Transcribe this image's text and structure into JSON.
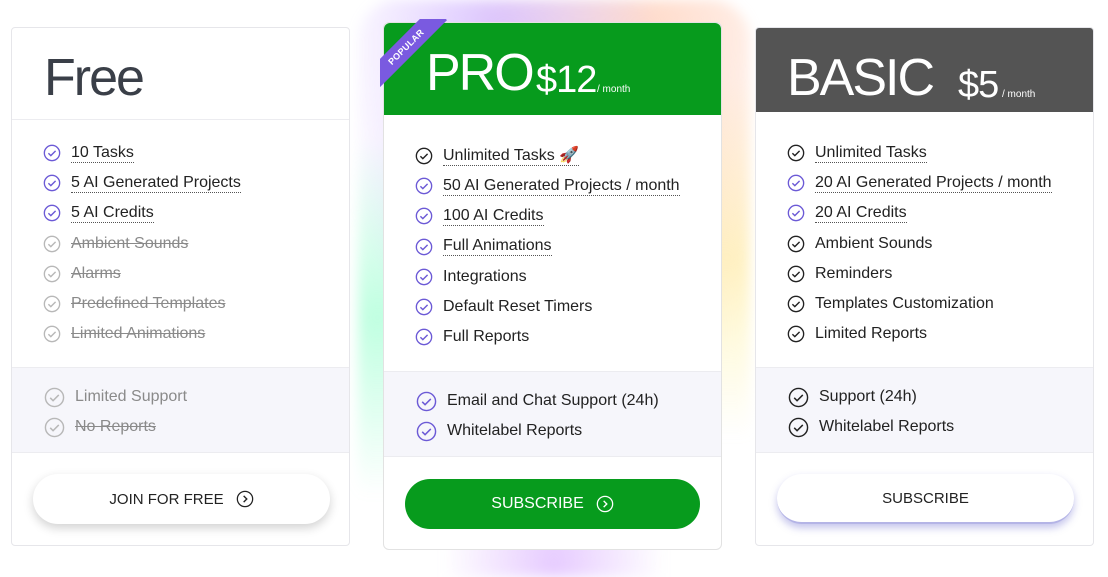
{
  "plans": {
    "free": {
      "name": "Free",
      "features": [
        {
          "text": "10 Tasks",
          "state": "included"
        },
        {
          "text": "5 AI Generated Projects",
          "state": "included"
        },
        {
          "text": "5 AI Credits",
          "state": "included"
        },
        {
          "text": "Ambient Sounds",
          "state": "excluded"
        },
        {
          "text": "Alarms",
          "state": "excluded"
        },
        {
          "text": "Predefined Templates",
          "state": "excluded"
        },
        {
          "text": "Limited Animations",
          "state": "excluded"
        }
      ],
      "support": [
        "Limited Support",
        "No Reports"
      ],
      "button": "JOIN FOR FREE"
    },
    "pro": {
      "badge": "POPULAR",
      "name": "PRO",
      "price": "$12",
      "period": "/ month",
      "features": [
        "Unlimited Tasks 🚀",
        "50 AI Generated Projects / month",
        "100 AI Credits",
        "Full Animations",
        "Integrations",
        "Default Reset Timers",
        "Full Reports"
      ],
      "support": [
        "Email and Chat Support (24h)",
        "Whitelabel Reports"
      ],
      "button": "SUBSCRIBE"
    },
    "basic": {
      "name": "BASIC",
      "price": "$5",
      "period": "/ month",
      "features": [
        "Unlimited Tasks",
        "20 AI Generated Projects / month",
        "20 AI Credits",
        "Ambient Sounds",
        "Reminders",
        "Templates Customization",
        "Limited Reports"
      ],
      "support": [
        "Support (24h)",
        "Whitelabel Reports"
      ],
      "button": "SUBSCRIBE"
    }
  },
  "colors": {
    "pro_green": "#079b1d",
    "basic_gray": "#545454",
    "check_purple": "#6c5ad6",
    "badge_purple": "#7a5ae0"
  }
}
